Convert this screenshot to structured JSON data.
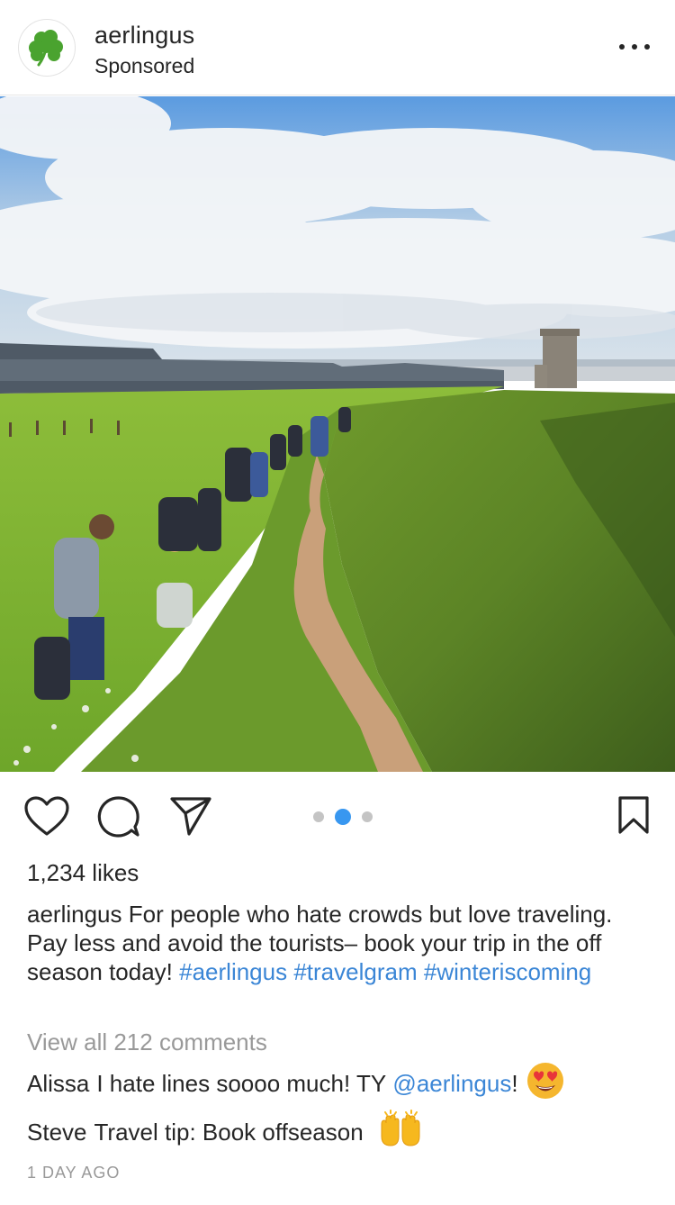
{
  "post": {
    "account": "aerlingus",
    "sponsored_label": "Sponsored",
    "more_icon": "more-horizontal-icon",
    "avatar_icon": "shamrock-icon",
    "brand_color": "#4aa32f"
  },
  "carousel": {
    "total": 3,
    "active_index": 1,
    "active_color": "#3897f0"
  },
  "actions": {
    "like_icon": "heart-icon",
    "comment_icon": "comment-bubble-icon",
    "share_icon": "paper-plane-icon",
    "save_icon": "bookmark-icon"
  },
  "likes": "1,234 likes",
  "caption": {
    "user": "aerlingus",
    "text": "For people who hate crowds but love traveling. Pay less and avoid the tourists– book your trip in the off season today!",
    "hashtags": [
      "#aerlingus",
      "#travelgram",
      "#winteriscoming"
    ]
  },
  "view_all": "View all 212 comments",
  "comments": [
    {
      "user": "Alissa",
      "text_before": "I hate lines soooo much! TY",
      "mention": "@aerlingus",
      "text_after": "!",
      "emoji": "heart-eyes-emoji"
    },
    {
      "user": "Steve",
      "text": "Travel tip: Book offseason",
      "emoji": "raising-hands-emoji"
    }
  ],
  "timestamp": "1 DAY AGO"
}
